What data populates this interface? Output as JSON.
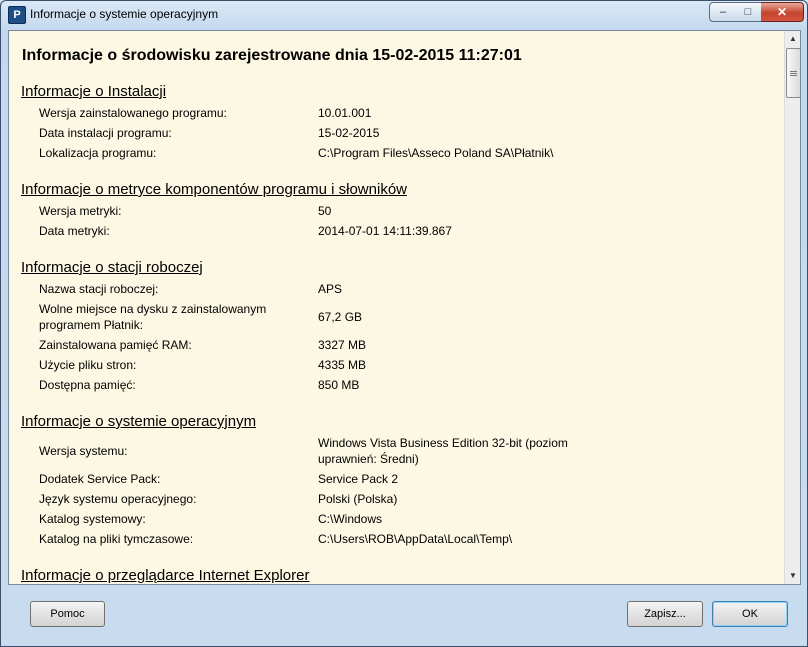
{
  "window": {
    "title": "Informacje o systemie operacyjnym",
    "app_icon": "P"
  },
  "main_title": "Informacje o środowisku zarejestrowane dnia 15-02-2015 11:27:01",
  "sections": {
    "install": {
      "header": "Informacje o Instalacji",
      "rows": [
        {
          "label": "Wersja zainstalowanego programu:",
          "value": "10.01.001"
        },
        {
          "label": "Data instalacji programu:",
          "value": "15-02-2015"
        },
        {
          "label": "Lokalizacja programu:",
          "value": "C:\\Program Files\\Asseco Poland SA\\Płatnik\\"
        }
      ]
    },
    "metric": {
      "header": "Informacje o metryce komponentów programu i słowników",
      "rows": [
        {
          "label": "Wersja metryki:",
          "value": "50"
        },
        {
          "label": "Data metryki:",
          "value": "2014-07-01 14:11:39.867"
        }
      ]
    },
    "workstation": {
      "header": "Informacje o stacji roboczej",
      "rows": [
        {
          "label": "Nazwa stacji roboczej:",
          "value": "APS"
        },
        {
          "label": "Wolne miejsce na dysku z zainstalowanym programem Płatnik:",
          "value": "67,2 GB"
        },
        {
          "label": "Zainstalowana pamięć RAM:",
          "value": "3327 MB"
        },
        {
          "label": "Użycie pliku stron:",
          "value": "4335 MB"
        },
        {
          "label": "Dostępna pamięć:",
          "value": "850 MB"
        }
      ]
    },
    "os": {
      "header": "Informacje o systemie operacyjnym",
      "rows": [
        {
          "label": "Wersja systemu:",
          "value": "Windows Vista Business Edition 32-bit (poziom uprawnień: Średni)"
        },
        {
          "label": "Dodatek Service Pack:",
          "value": "Service Pack 2"
        },
        {
          "label": "Język systemu operacyjnego:",
          "value": "Polski (Polska)"
        },
        {
          "label": "Katalog systemowy:",
          "value": "C:\\Windows"
        },
        {
          "label": "Katalog na pliki tymczasowe:",
          "value": "C:\\Users\\ROB\\AppData\\Local\\Temp\\"
        }
      ]
    },
    "ie": {
      "header": "Informacje o przeglądarce Internet Explorer"
    }
  },
  "buttons": {
    "help": "Pomoc",
    "save": "Zapisz...",
    "ok": "OK"
  },
  "window_controls": {
    "minimize": "–",
    "maximize": "□",
    "close": "✕"
  },
  "scrollbar": {
    "up": "▲",
    "down": "▼"
  }
}
